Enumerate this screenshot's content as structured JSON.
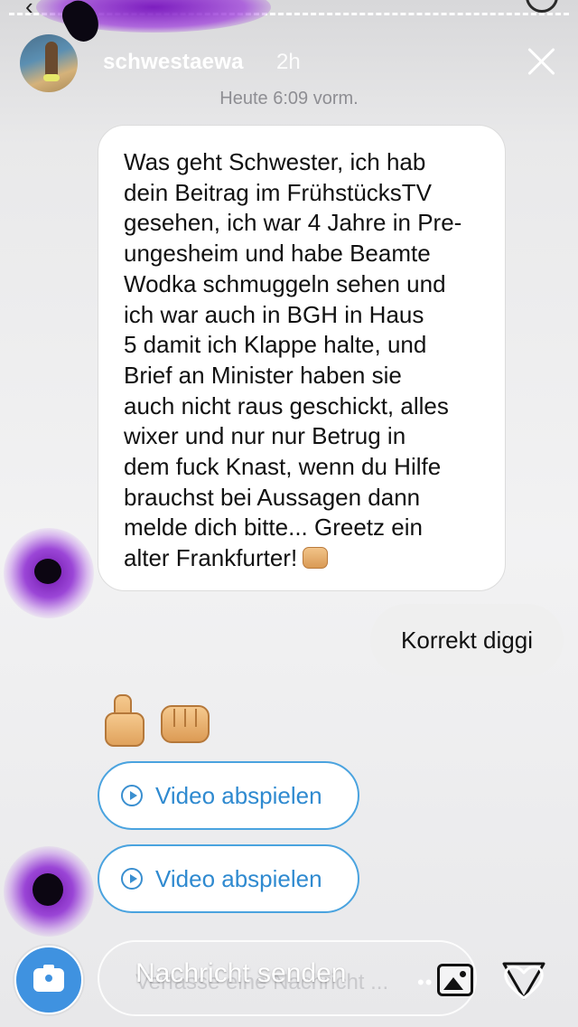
{
  "story": {
    "username": "schwestaewa",
    "time_ago": "2h"
  },
  "thread": {
    "timestamp": "Heute 6:09 vorm.",
    "incoming_message": [
      "Was geht Schwester, ich hab",
      "dein Beitrag im FrühstücksTV",
      "gesehen, ich war 4 Jahre in Pre-",
      "ungesheim und habe Beamte",
      "Wodka schmuggeln sehen und",
      "ich war auch in BGH in Haus",
      "5 damit ich Klappe halte, und",
      "Brief an Minister haben sie",
      "auch nicht raus geschickt, alles",
      "wixer und nur nur Betrug in",
      "dem fuck Knast, wenn du Hilfe",
      "brauchst bei Aussagen dann",
      "melde dich bitte... Greetz ein",
      "alter Frankfurter!"
    ],
    "outgoing_message": "Korrekt diggi",
    "emoji_reaction": [
      "thumbs-up",
      "fist"
    ],
    "video_buttons": [
      {
        "label": "Video abspielen"
      },
      {
        "label": "Video abspielen"
      }
    ]
  },
  "composer": {
    "placeholder": "Verfasse eine Nachricht ...",
    "overlay_text": "Nachricht senden",
    "dots": "••"
  },
  "colors": {
    "accent_blue": "#3a8fd0",
    "scribble_purple": "#8a2bd6"
  }
}
